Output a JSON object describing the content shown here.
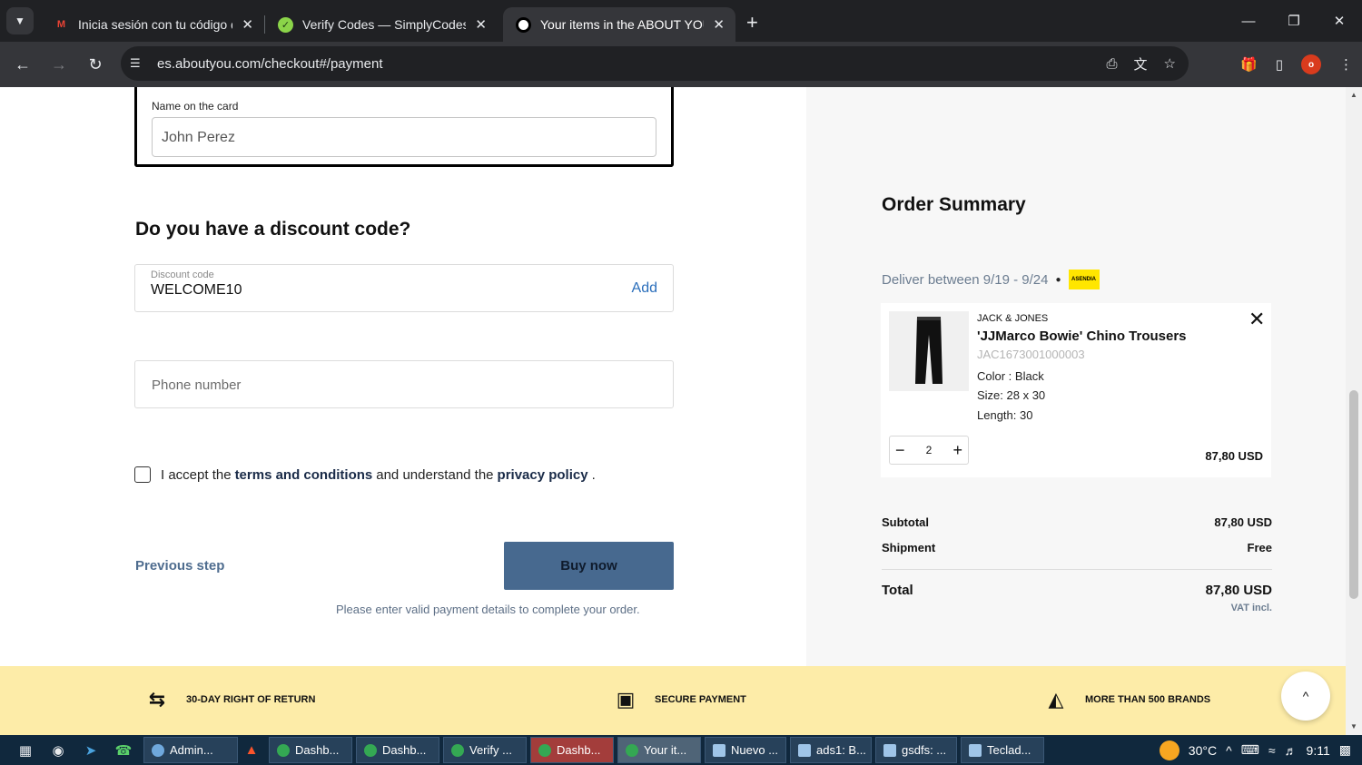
{
  "browser": {
    "tabs": [
      {
        "title": "Inicia sesión con tu código de v",
        "active": false,
        "favicon": "gmail-icon"
      },
      {
        "title": "Verify Codes — SimplyCodes",
        "active": false,
        "favicon": "simplycodes-icon"
      },
      {
        "title": "Your items in the ABOUT YOU b",
        "active": true,
        "favicon": "aboutyou-icon"
      }
    ],
    "url": "es.aboutyou.com/checkout#/payment",
    "profile_initial": "o"
  },
  "payment": {
    "name_on_card_label": "Name on the card",
    "name_on_card_value": "John Perez"
  },
  "discount": {
    "heading": "Do you have a discount code?",
    "label": "Discount code",
    "value": "WELCOME10",
    "add_label": "Add"
  },
  "phone": {
    "placeholder": "Phone number"
  },
  "terms": {
    "prefix": "I accept the",
    "terms_link": "terms and conditions",
    "middle": "and understand the",
    "privacy_link": "privacy policy",
    "suffix": ".",
    "checked": false
  },
  "actions": {
    "previous_label": "Previous step",
    "buy_label": "Buy now",
    "note": "Please enter valid payment details to complete your order."
  },
  "summary": {
    "title": "Order Summary",
    "deliver_text": "Deliver between 9/19 - 9/24",
    "carrier_label": "ASENDIA",
    "item": {
      "brand": "JACK & JONES",
      "name": "'JJMarco Bowie' Chino Trousers",
      "sku": "JAC1673001000003",
      "color": "Color : Black",
      "size": "Size: 28 x 30",
      "length": "Length: 30",
      "quantity": "2",
      "price": "87,80 USD"
    },
    "subtotal_label": "Subtotal",
    "subtotal_value": "87,80 USD",
    "shipment_label": "Shipment",
    "shipment_value": "Free",
    "total_label": "Total",
    "total_value": "87,80 USD",
    "vat_note": "VAT incl."
  },
  "benefits": [
    {
      "label": "30-DAY RIGHT OF RETURN",
      "icon": "return-arrows-icon"
    },
    {
      "label": "SECURE PAYMENT",
      "icon": "secure-card-icon"
    },
    {
      "label": "MORE THAN 500 BRANDS",
      "icon": "shirt-icon"
    }
  ],
  "taskbar": {
    "tasks": [
      {
        "label": "Admin...",
        "color": "#6fa8dc"
      },
      {
        "label": "Dashb...",
        "color": "#34a853"
      },
      {
        "label": "Dashb...",
        "color": "#34a853"
      },
      {
        "label": "Verify ...",
        "color": "#34a853"
      },
      {
        "label": "Dashb...",
        "color": "#34a853"
      },
      {
        "label": "Your it...",
        "color": "#34a853"
      },
      {
        "label": "Nuevo ...",
        "color": "#9fc5e8"
      },
      {
        "label": "ads1: B...",
        "color": "#9fc5e8"
      },
      {
        "label": "gsdfs: ...",
        "color": "#9fc5e8"
      },
      {
        "label": "Teclad...",
        "color": "#9fc5e8"
      }
    ],
    "temperature": "30°C",
    "time": "9:11"
  }
}
